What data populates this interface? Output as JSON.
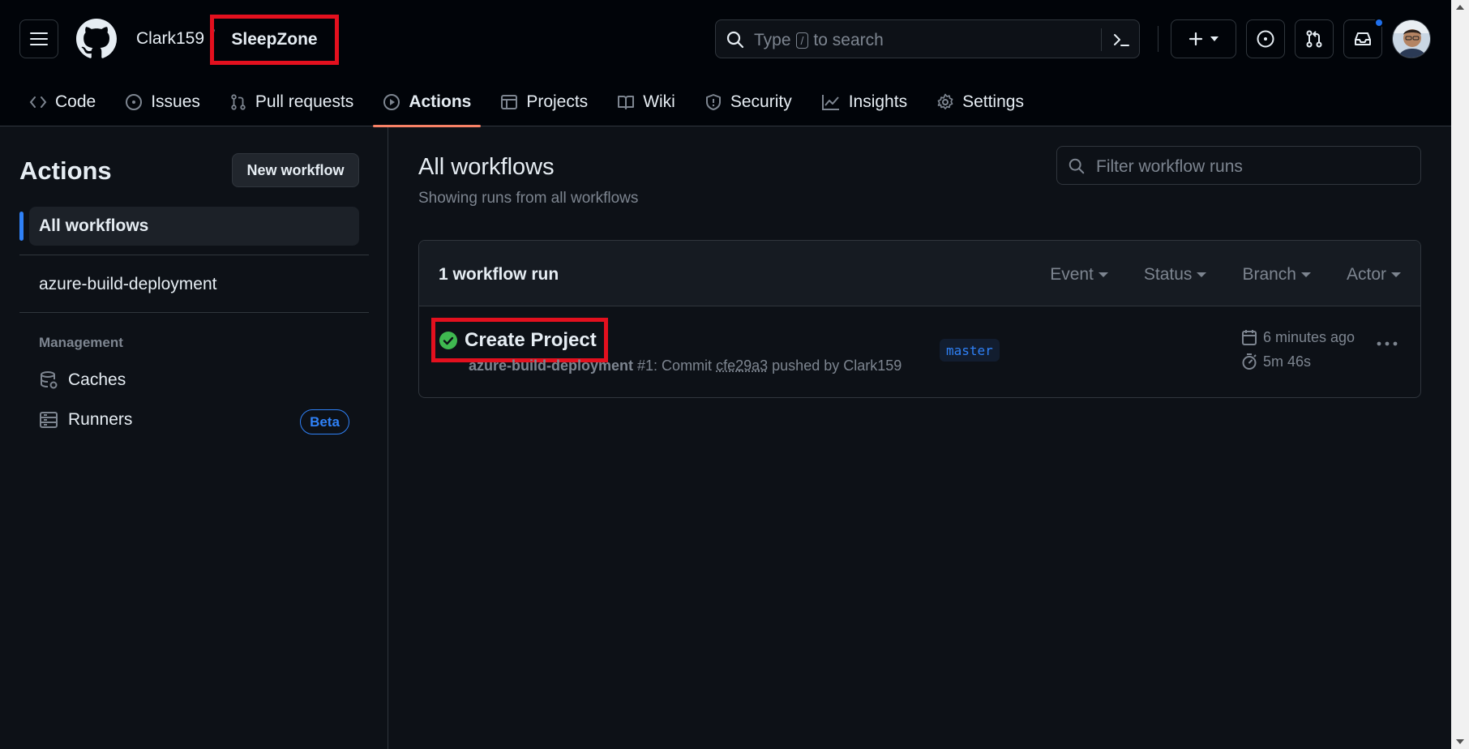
{
  "header": {
    "owner": "Clark159",
    "repo": "SleepZone",
    "search_placeholder_pre": "Type",
    "search_key": "/",
    "search_placeholder_post": "to search"
  },
  "nav": {
    "tabs": [
      {
        "label": "Code",
        "icon": "code-icon"
      },
      {
        "label": "Issues",
        "icon": "issue-opened-icon"
      },
      {
        "label": "Pull requests",
        "icon": "git-pull-request-icon"
      },
      {
        "label": "Actions",
        "icon": "play-icon",
        "active": true
      },
      {
        "label": "Projects",
        "icon": "table-icon"
      },
      {
        "label": "Wiki",
        "icon": "book-icon"
      },
      {
        "label": "Security",
        "icon": "shield-icon"
      },
      {
        "label": "Insights",
        "icon": "graph-icon"
      },
      {
        "label": "Settings",
        "icon": "gear-icon"
      }
    ]
  },
  "sidebar": {
    "title": "Actions",
    "new_workflow": "New workflow",
    "all_workflows": "All workflows",
    "workflows": [
      "azure-build-deployment"
    ],
    "management_heading": "Management",
    "caches": "Caches",
    "runners": "Runners",
    "beta_badge": "Beta"
  },
  "main": {
    "title": "All workflows",
    "subtitle": "Showing runs from all workflows",
    "filter_placeholder": "Filter workflow runs",
    "runs_count": "1 workflow run",
    "filters": [
      "Event",
      "Status",
      "Branch",
      "Actor"
    ],
    "runs": [
      {
        "title": "Create Project",
        "workflow": "azure-build-deployment",
        "meta_mid": "#1: Commit",
        "sha": "cfe29a3",
        "meta_tail": "pushed by Clark159",
        "branch": "master",
        "time_ago": "6 minutes ago",
        "duration": "5m 46s",
        "status": "success"
      }
    ]
  },
  "colors": {
    "accent": "#2f81f7",
    "success": "#3fb950",
    "active_tab_underline": "#f78166",
    "highlight_box": "#e3101e"
  }
}
